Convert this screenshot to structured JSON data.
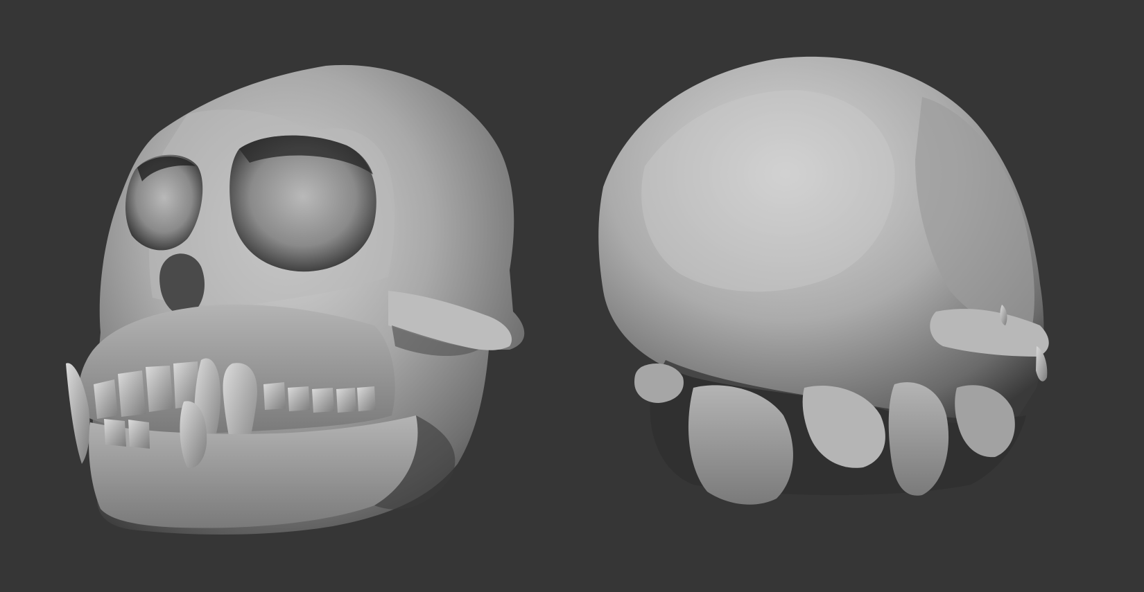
{
  "scene": {
    "background_color": "#363636",
    "material_color": "#9a9a9a",
    "highlight_color": "#d2d2d2",
    "shadow_color": "#262626",
    "objects": [
      {
        "name": "skull-front-three-quarter-view"
      },
      {
        "name": "skull-back-three-quarter-view"
      }
    ]
  }
}
